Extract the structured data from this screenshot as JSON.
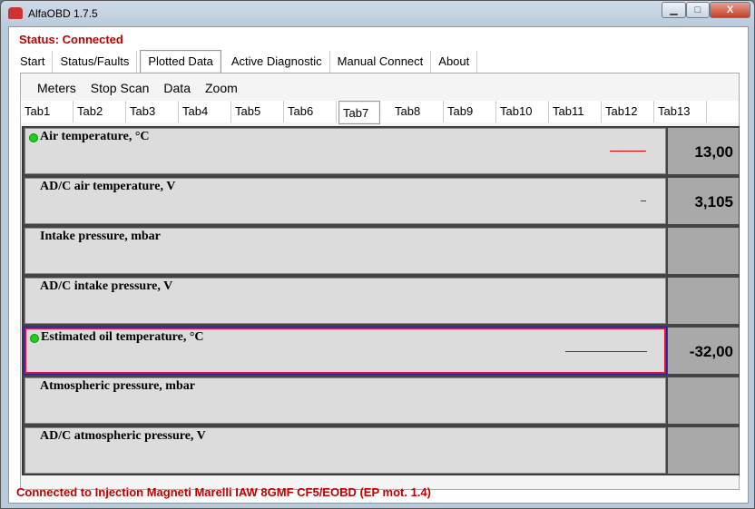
{
  "window": {
    "title": "AlfaOBD 1.7.5",
    "min": "▁",
    "max": "□",
    "close": "X"
  },
  "status": "Status: Connected",
  "main_tabs": [
    "Start",
    "Status/Faults",
    "Plotted Data",
    "Active Diagnostic",
    "Manual Connect",
    "About"
  ],
  "selected_main_tab": "Plotted Data",
  "menu": [
    "Meters",
    "Stop Scan",
    "Data",
    "Zoom"
  ],
  "sub_tabs": [
    "Tab1",
    "Tab2",
    "Tab3",
    "Tab4",
    "Tab5",
    "Tab6",
    "Tab7",
    "Tab8",
    "Tab9",
    "Tab10",
    "Tab11",
    "Tab12",
    "Tab13"
  ],
  "selected_sub_tab": "Tab7",
  "rows": [
    {
      "label": "Air temperature, °C",
      "value": "13,00",
      "active": true
    },
    {
      "label": "AD/C air temperature, V",
      "value": "3,105",
      "active": false
    },
    {
      "label": "Intake pressure, mbar",
      "value": "",
      "active": false
    },
    {
      "label": "AD/C intake pressure, V",
      "value": "",
      "active": false
    },
    {
      "label": "Estimated oil temperature, °C",
      "value": "-32,00",
      "active": true,
      "selected": true
    },
    {
      "label": "Atmospheric pressure, mbar",
      "value": "",
      "active": false
    },
    {
      "label": "AD/C atmospheric pressure, V",
      "value": "",
      "active": false
    }
  ],
  "footer": "Connected to Injection Magneti Marelli IAW 8GMF CF5/EOBD (EP mot. 1.4)"
}
